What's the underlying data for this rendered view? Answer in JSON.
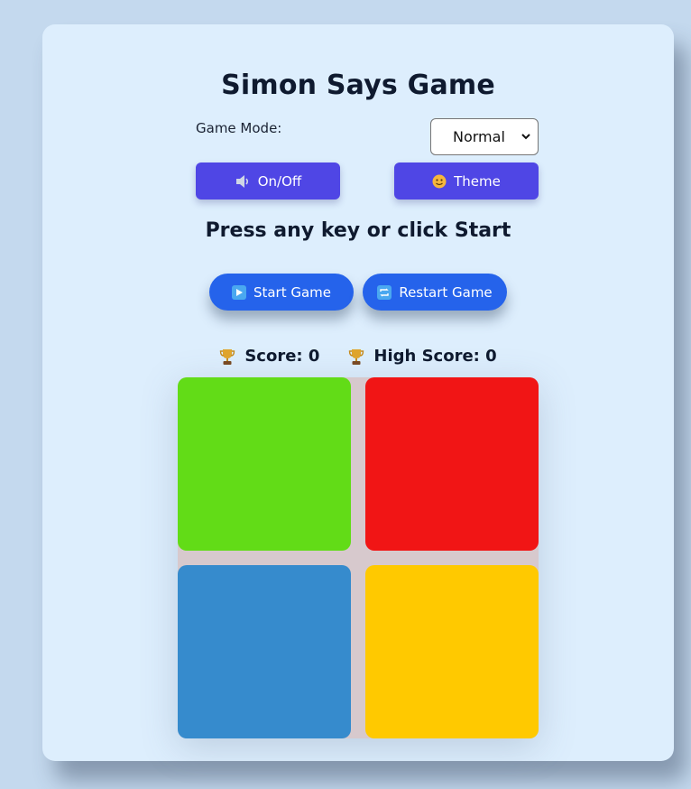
{
  "game": {
    "title": "Simon Says Game",
    "mode_label": "Game Mode:",
    "mode_selected": "Normal",
    "sound_button": "On/Off",
    "theme_button": "Theme",
    "status_message": "Press any key or click Start",
    "start_button": "Start Game",
    "restart_button": "Restart Game",
    "score_text": "Score: 0",
    "high_score_text": "High Score: 0"
  },
  "icons": {
    "sound": "speaker-icon",
    "theme": "theme-face-icon",
    "start": "play-icon",
    "restart": "repeat-icon",
    "score": "trophy-icon",
    "high_score": "trophy-icon"
  },
  "colors": {
    "card_bg": "#ddeefd",
    "page_bg": "#c4d9ee",
    "control_button": "#4f46e5",
    "action_button": "#2563eb",
    "pad_green": "#62dc17",
    "pad_red": "#f11515",
    "pad_blue": "#368bcd",
    "pad_yellow": "#ffc900",
    "board_bg": "#d7c9cd"
  }
}
